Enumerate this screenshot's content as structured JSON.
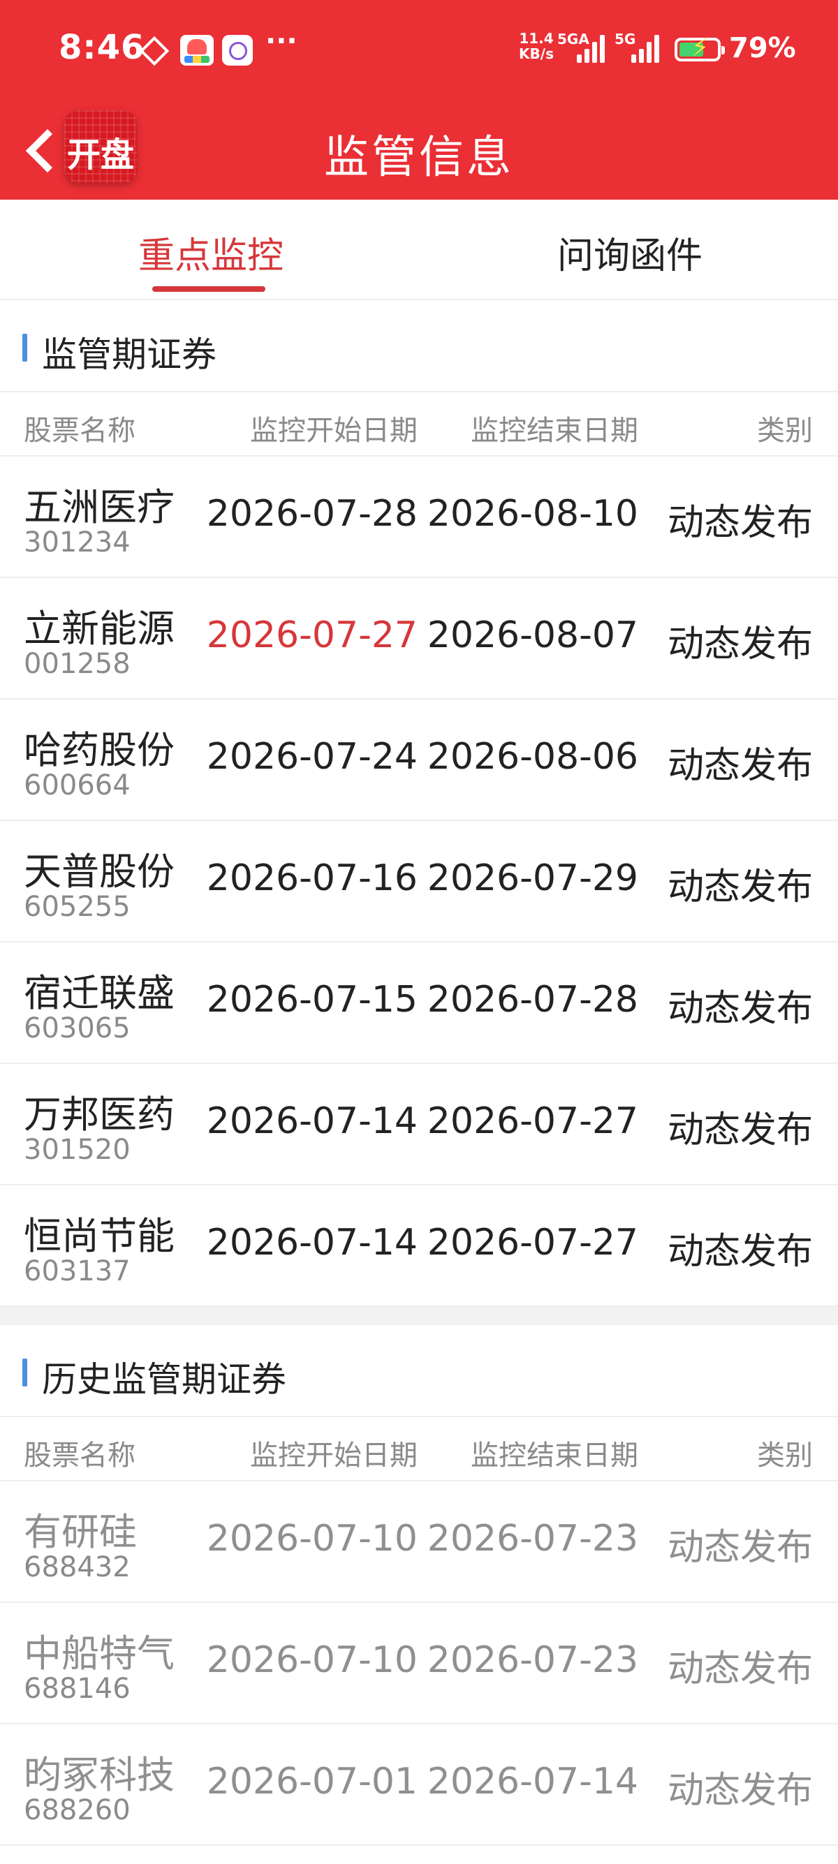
{
  "status_bar": {
    "time": "8:46",
    "net_speed_value": "11.4",
    "net_speed_unit": "KB/s",
    "sig1_label": "5GA",
    "sig2_label": "5G",
    "battery": "79%",
    "more": "···"
  },
  "header": {
    "app_logo_text": "开盘",
    "title": "监管信息"
  },
  "tabs": [
    {
      "label": "重点监控",
      "active": true
    },
    {
      "label": "问询函件",
      "active": false
    }
  ],
  "sections": {
    "current": {
      "title": "监管期证券",
      "columns": [
        "股票名称",
        "监控开始日期",
        "监控结束日期",
        "类别"
      ],
      "rows": [
        {
          "name": "五洲医疗",
          "code": "301234",
          "start": "2026-07-28",
          "end": "2026-08-10",
          "category": "动态发布"
        },
        {
          "name": "立新能源",
          "code": "001258",
          "start": "2026-07-27",
          "end": "2026-08-07",
          "category": "动态发布",
          "start_highlight": true
        },
        {
          "name": "哈药股份",
          "code": "600664",
          "start": "2026-07-24",
          "end": "2026-08-06",
          "category": "动态发布"
        },
        {
          "name": "天普股份",
          "code": "605255",
          "start": "2026-07-16",
          "end": "2026-07-29",
          "category": "动态发布"
        },
        {
          "name": "宿迁联盛",
          "code": "603065",
          "start": "2026-07-15",
          "end": "2026-07-28",
          "category": "动态发布"
        },
        {
          "name": "万邦医药",
          "code": "301520",
          "start": "2026-07-14",
          "end": "2026-07-27",
          "category": "动态发布"
        },
        {
          "name": "恒尚节能",
          "code": "603137",
          "start": "2026-07-14",
          "end": "2026-07-27",
          "category": "动态发布"
        }
      ]
    },
    "history": {
      "title": "历史监管期证券",
      "columns": [
        "股票名称",
        "监控开始日期",
        "监控结束日期",
        "类别"
      ],
      "rows": [
        {
          "name": "有研硅",
          "code": "688432",
          "start": "2026-07-10",
          "end": "2026-07-23",
          "category": "动态发布"
        },
        {
          "name": "中船特气",
          "code": "688146",
          "start": "2026-07-10",
          "end": "2026-07-23",
          "category": "动态发布"
        },
        {
          "name": "昀冢科技",
          "code": "688260",
          "start": "2026-07-01",
          "end": "2026-07-14",
          "category": "动态发布"
        }
      ]
    }
  },
  "colors": {
    "brand_red": "#ea2f35",
    "active_tab": "#d6373a",
    "section_accent": "#4a90e2",
    "muted_text": "#8a8a8a"
  }
}
